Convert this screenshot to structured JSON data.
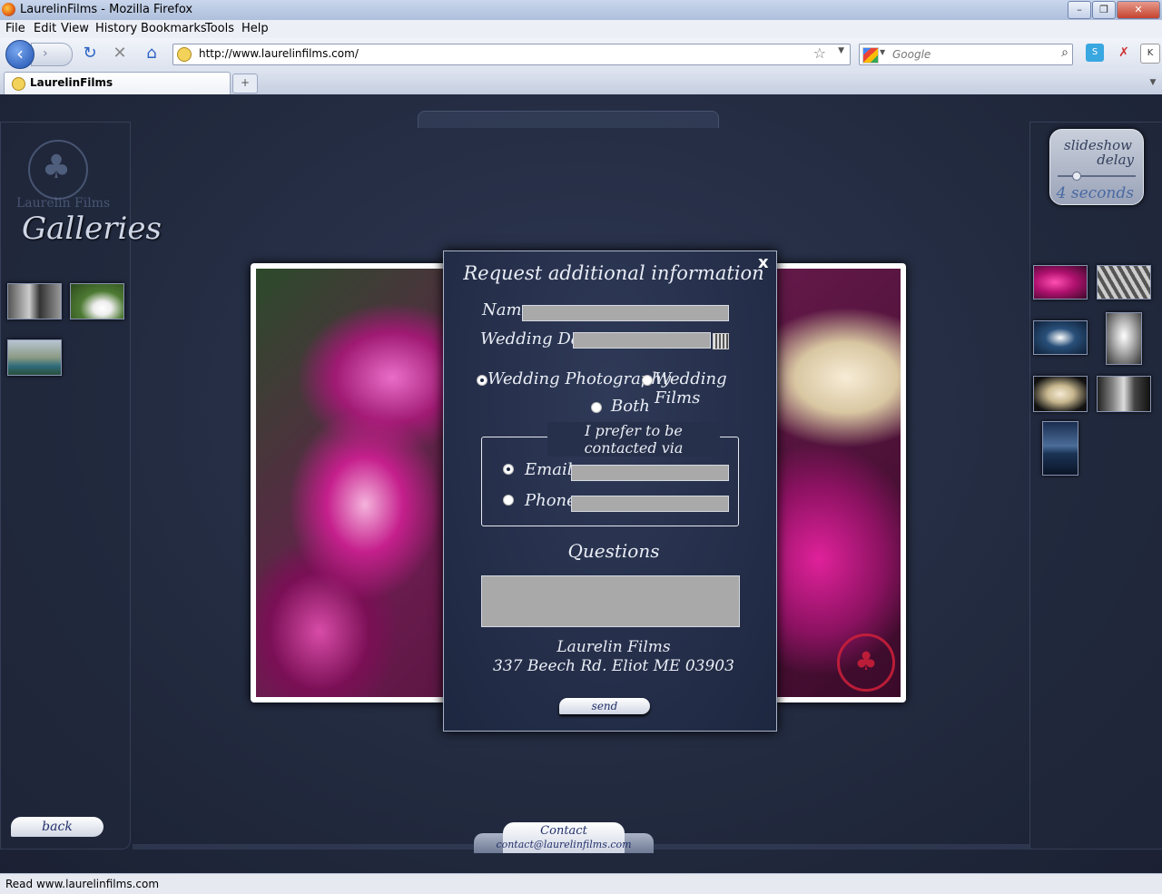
{
  "window": {
    "title": "LaurelinFilms - Mozilla Firefox",
    "min": "–",
    "max": "❐",
    "close": "✕"
  },
  "menu": [
    "File",
    "Edit",
    "View",
    "History",
    "Bookmarks",
    "Tools",
    "Help"
  ],
  "nav": {
    "url": "http://www.laurelinfilms.com/",
    "search_placeholder": "Google",
    "back": "‹",
    "fwd": "›",
    "reload": "↻",
    "stop": "✕",
    "home": "⌂"
  },
  "tabs": [
    {
      "label": "LaurelinFilms"
    }
  ],
  "tab_new": "+",
  "site": {
    "logo_text": "Laurelin Films",
    "galleries_title": "Galleries",
    "back_label": "back",
    "slideshow": {
      "line1": "slideshow",
      "line2": "delay",
      "value": "4 seconds",
      "level_fraction": 0.2
    },
    "contact": {
      "label": "Contact",
      "email": "contact@laurelinfilms.com"
    }
  },
  "form": {
    "title": "Request additional information",
    "close": "x",
    "name_label": "Name",
    "date_label": "Wedding Da",
    "options": {
      "photo": "Wedding Photography",
      "films": "Wedding Films",
      "both": "Both",
      "selected": "photo"
    },
    "legend": "I prefer to be contacted via",
    "email_label": "Email",
    "phone_label": "Phone",
    "questions_label": "Questions",
    "company": "Laurelin Films",
    "address": "337 Beech Rd. Eliot ME 03903",
    "send": "send"
  },
  "status": "Read www.laurelinfilms.com",
  "colors": {
    "page_bg": "#222a3f",
    "accent": "#22306a",
    "field": "#a9a9a9"
  }
}
